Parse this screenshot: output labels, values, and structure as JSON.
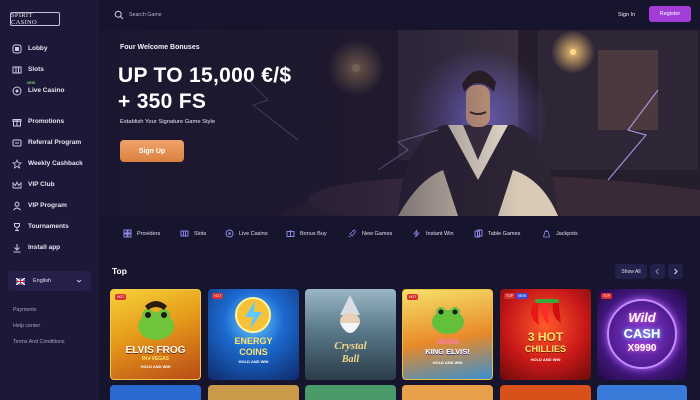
{
  "brand": {
    "logo_text": "SPIRIT CASINO"
  },
  "sidebar": {
    "items": [
      {
        "label": "Lobby",
        "icon": "lobby-icon"
      },
      {
        "label": "Slots",
        "icon": "slots-icon"
      },
      {
        "label": "Live Casino",
        "icon": "live-casino-icon",
        "badge": "NEW"
      },
      {
        "label": "Promotions",
        "icon": "gift-icon"
      },
      {
        "label": "Referral Program",
        "icon": "referral-icon"
      },
      {
        "label": "Weekly Cashback",
        "icon": "star-icon"
      },
      {
        "label": "VIP Club",
        "icon": "crown-icon"
      },
      {
        "label": "VIP Program",
        "icon": "user-icon"
      },
      {
        "label": "Tournaments",
        "icon": "trophy-icon"
      },
      {
        "label": "Install app",
        "icon": "download-icon"
      }
    ],
    "language": "English",
    "footer_links": [
      "Payments",
      "Help center",
      "Terms And Conditions"
    ]
  },
  "header": {
    "search_placeholder": "Search Game",
    "signin_label": "Sign In",
    "register_label": "Register"
  },
  "hero": {
    "subtitle": "Four Welcome Bonuses",
    "title_line1": "UP TO 15,000 €/$",
    "title_line2": "+ 350 FS",
    "description": "Establish Your Signature Game Style",
    "cta_label": "Sign Up"
  },
  "categories": [
    {
      "label": "Providers",
      "icon": "providers-icon"
    },
    {
      "label": "Slots",
      "icon": "slots-icon"
    },
    {
      "label": "Live Casino",
      "icon": "live-casino-icon"
    },
    {
      "label": "Bonus Buy",
      "icon": "bonus-buy-icon"
    },
    {
      "label": "New Games",
      "icon": "rocket-icon"
    },
    {
      "label": "Instant Win",
      "icon": "lightning-icon"
    },
    {
      "label": "Table Games",
      "icon": "cards-icon"
    },
    {
      "label": "Jackpots",
      "icon": "bag-icon"
    }
  ],
  "top_section": {
    "title": "Top",
    "show_all_label": "Show All",
    "games": [
      {
        "line1": "ELVIS FROG",
        "line2": "IN★VEGAS",
        "line3": "HOLD AND WIN",
        "tags": [
          "HOT"
        ]
      },
      {
        "line1": "ENERGY",
        "line2": "COINS",
        "line3": "HOLD AND WIN",
        "tags": [
          "HOT"
        ]
      },
      {
        "line1": "Crystal",
        "line2": "Ball",
        "line3": "",
        "tags": []
      },
      {
        "line1": "Aloha",
        "line2": "KING ELVIS!",
        "line3": "HOLD AND WIN",
        "tags": [
          "HOT"
        ]
      },
      {
        "line1": "3 HOT",
        "line2": "CHILLIES",
        "line3": "HOLD AND WIN",
        "tags": [
          "TOP",
          "NEW"
        ]
      },
      {
        "line1": "Wild",
        "line2": "CASH",
        "line3": "X9990",
        "tags": [
          "TOP"
        ]
      }
    ]
  },
  "colors": {
    "accent_register": "#a23dd8",
    "cta_orange": "#e08a4a",
    "bg": "#17142e"
  }
}
